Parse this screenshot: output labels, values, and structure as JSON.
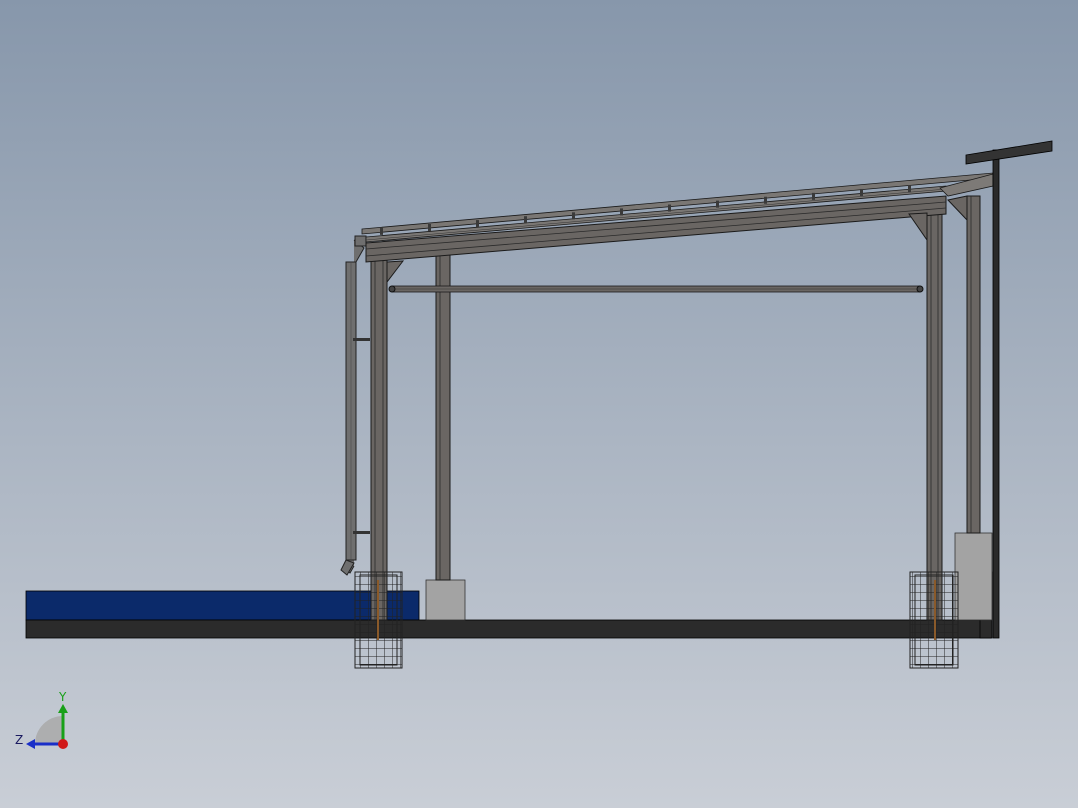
{
  "viewport": {
    "background_top": "#8797ab",
    "background_bottom": "#c9ced6"
  },
  "model": {
    "steel_color": "#6a6663",
    "steel_edge": "#1a1a1a",
    "concrete_color": "#2b2b2b",
    "pier_color": "#a3a3a3",
    "water_color": "#0b2a6a",
    "rebar_color": "#222222",
    "pipe_color": "#6f6f6f"
  },
  "triad": {
    "y_label": "Y",
    "z_label": "Z",
    "y_color": "#18a018",
    "z_color": "#1a2fc8",
    "x_color": "#d01818"
  }
}
